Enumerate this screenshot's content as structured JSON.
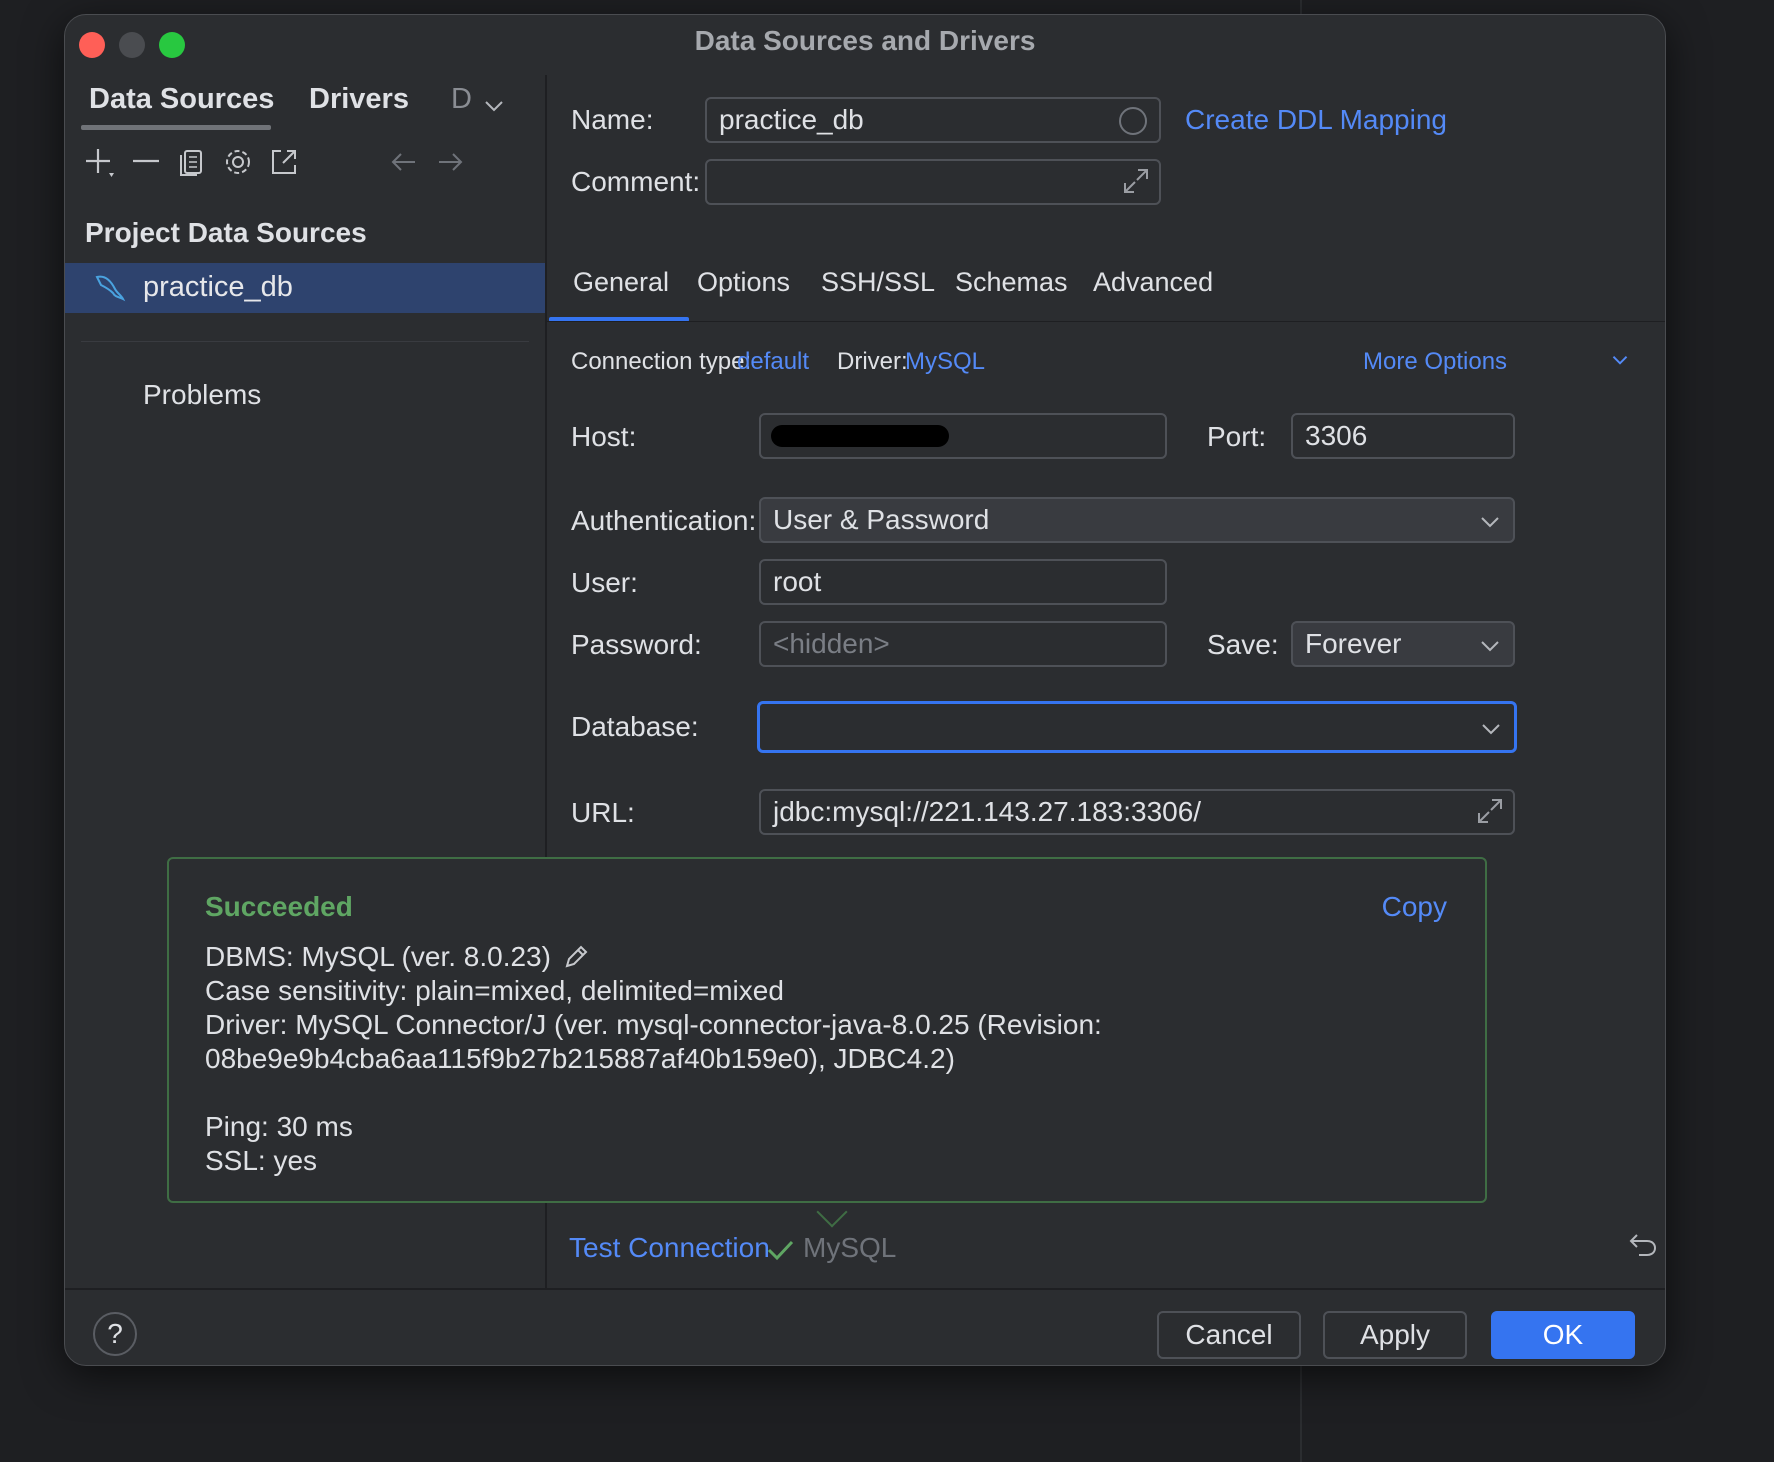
{
  "window": {
    "title": "Data Sources and Drivers"
  },
  "left_tabs": [
    {
      "label": "Data Sources"
    },
    {
      "label": "Drivers"
    },
    {
      "label": "D"
    }
  ],
  "tree": {
    "section_title": "Project Data Sources",
    "items": [
      {
        "label": "practice_db"
      }
    ],
    "problems_label": "Problems"
  },
  "form": {
    "name_label": "Name:",
    "name_value": "practice_db",
    "comment_label": "Comment:",
    "comment_value": "",
    "ddl_link": "Create DDL Mapping"
  },
  "tabs": [
    {
      "label": "General",
      "active": true
    },
    {
      "label": "Options"
    },
    {
      "label": "SSH/SSL"
    },
    {
      "label": "Schemas"
    },
    {
      "label": "Advanced"
    }
  ],
  "general": {
    "connection_type_label": "Connection type:",
    "connection_type_value": "default",
    "driver_label": "Driver:",
    "driver_value": "MySQL",
    "more_options": "More Options",
    "host_label": "Host:",
    "port_label": "Port:",
    "port_value": "3306",
    "auth_label": "Authentication:",
    "auth_value": "User & Password",
    "user_label": "User:",
    "user_value": "root",
    "password_label": "Password:",
    "password_placeholder": "<hidden>",
    "save_label": "Save:",
    "save_value": "Forever",
    "database_label": "Database:",
    "database_value": "",
    "url_label": "URL:",
    "url_value": "jdbc:mysql://221.143.27.183:3306/"
  },
  "popup": {
    "status": "Succeeded",
    "copy_label": "Copy",
    "lines": [
      "DBMS: MySQL (ver. 8.0.23)",
      "Case sensitivity: plain=mixed, delimited=mixed",
      "Driver: MySQL Connector/J (ver. mysql-connector-java-8.0.25 (Revision:",
      "08be9e9b4cba6aa115f9b27b215887af40b159e0), JDBC4.2)",
      "",
      "Ping: 30 ms",
      "SSL: yes"
    ]
  },
  "test_connection": {
    "label": "Test Connection",
    "driver": "MySQL"
  },
  "buttons": {
    "help": "?",
    "cancel": "Cancel",
    "apply": "Apply",
    "ok": "OK"
  },
  "colors": {
    "accent": "#3574f0",
    "link": "#548af7",
    "success": "#5fa663",
    "selection": "#2e436e"
  }
}
